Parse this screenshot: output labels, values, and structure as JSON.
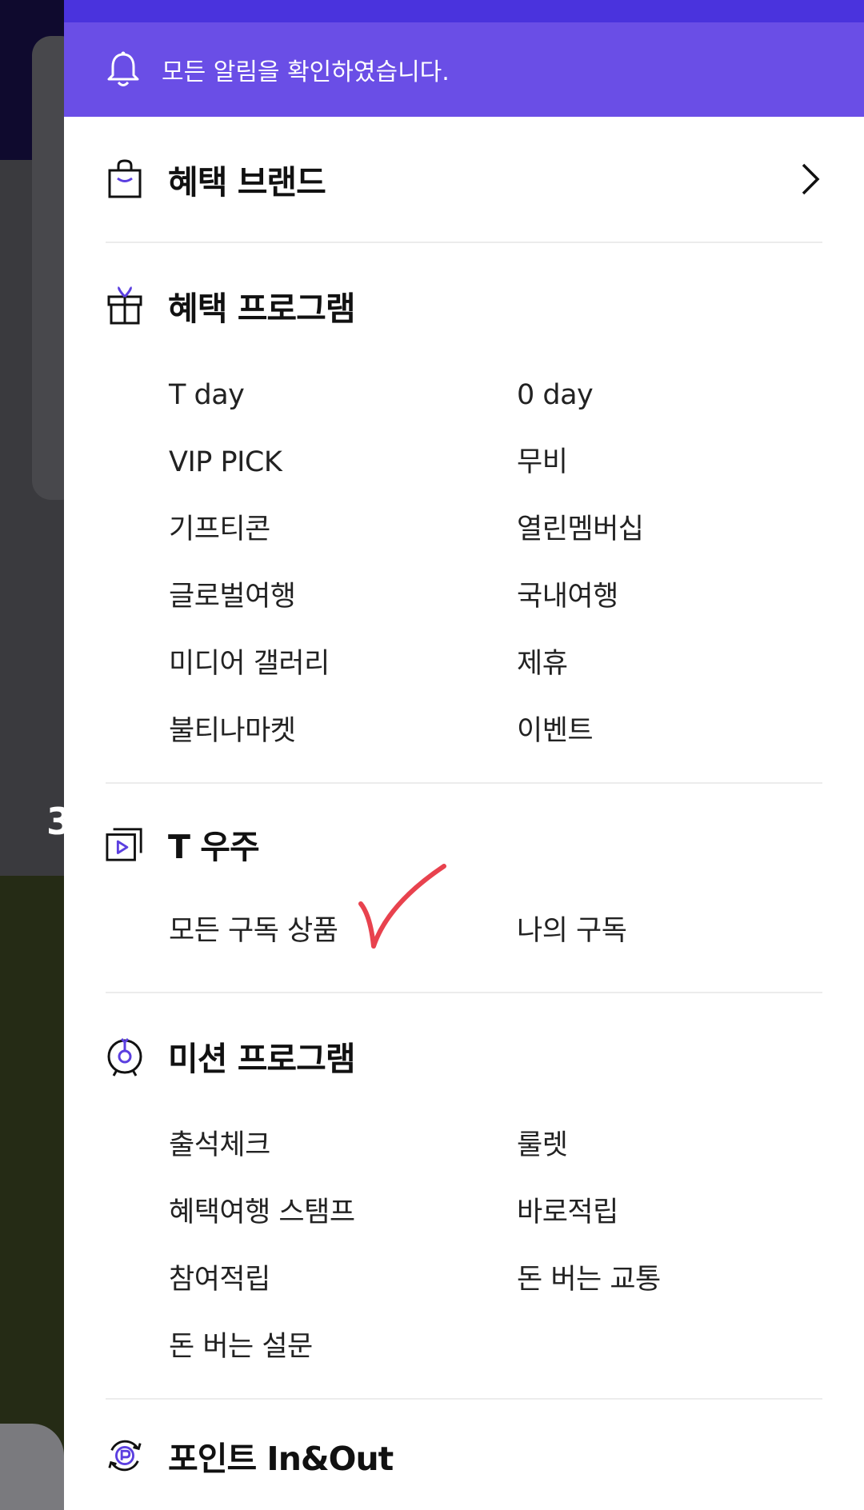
{
  "banner": {
    "text": "모든 알림을 확인하였습니다.",
    "icon": "bell-icon"
  },
  "brand_section": {
    "title": "혜택 브랜드",
    "icon": "shopping-bag-icon",
    "arrow": "chevron-right-icon"
  },
  "benefit_program": {
    "title": "혜택 프로그램",
    "icon": "gift-icon",
    "items": [
      "T day",
      "0 day",
      "VIP PICK",
      "무비",
      "기프티콘",
      "열린멤버십",
      "글로벌여행",
      "국내여행",
      "미디어 갤러리",
      "제휴",
      "불티나마켓",
      "이벤트"
    ]
  },
  "t_universe": {
    "title": "T 우주",
    "icon": "play-window-icon",
    "items": [
      "모든 구독 상품",
      "나의 구독"
    ]
  },
  "mission_program": {
    "title": "미션 프로그램",
    "icon": "target-icon",
    "items": [
      "출석체크",
      "룰렛",
      "혜택여행 스탬프",
      "바로적립",
      "참여적립",
      "돈 버는 교통",
      "돈 버는 설문"
    ]
  },
  "point_section": {
    "title": "포인트 In&Out",
    "icon": "point-cycle-icon"
  },
  "background": {
    "peek_text": "3"
  },
  "colors": {
    "banner_bg": "#6a4ee6",
    "banner_strip": "#4a33dd",
    "accent": "#5b3fe0",
    "check_mark": "#e8424e"
  }
}
